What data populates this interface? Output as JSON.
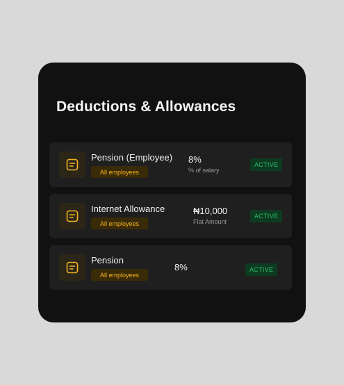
{
  "page": {
    "background": "#d9d9d9"
  },
  "card": {
    "title": "Deductions & Allowances",
    "background": "#111111"
  },
  "items": [
    {
      "name": "Pension (Employee)",
      "scope": "All employees",
      "value": "8%",
      "value_caption": "% of salary",
      "status": "ACTIVE",
      "icon": "document-icon"
    },
    {
      "name": "Internet Allowance",
      "scope": "All employees",
      "value": "₦10,000",
      "value_caption": "Flat Amount",
      "status": "ACTIVE",
      "icon": "document-icon"
    },
    {
      "name": "Pension",
      "scope": "All employees",
      "value": "8%",
      "value_caption": "",
      "status": "ACTIVE",
      "icon": "document-icon"
    }
  ],
  "colors": {
    "accent_amber": "#f5b321",
    "status_green": "#2fbf6a",
    "row_background": "#1f1f1f"
  }
}
